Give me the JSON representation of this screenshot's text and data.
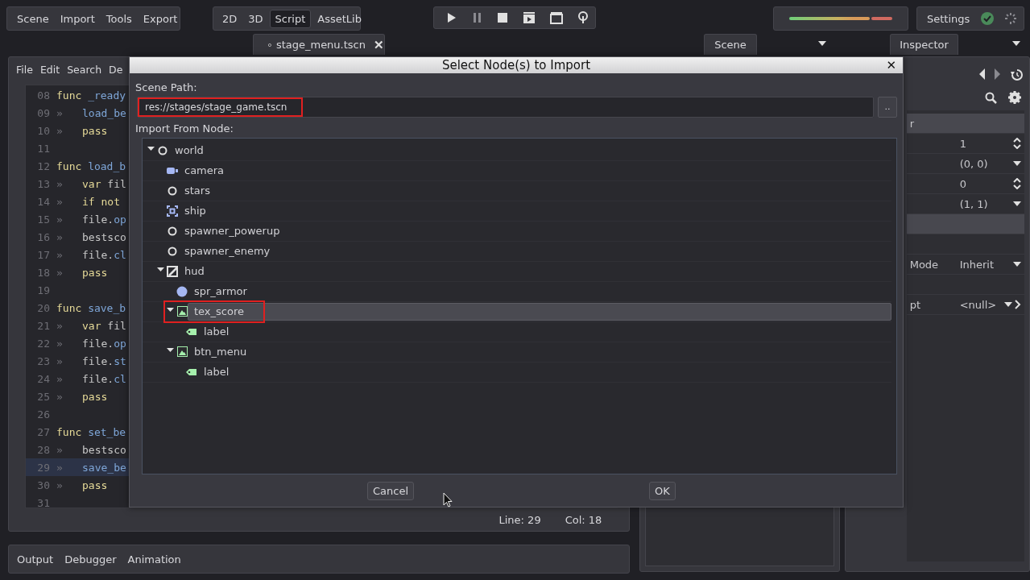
{
  "menu": [
    "Scene",
    "Import",
    "Tools",
    "Export"
  ],
  "main_tabs": [
    {
      "label": "2D",
      "selected": false
    },
    {
      "label": "3D",
      "selected": false
    },
    {
      "label": "Script",
      "selected": true
    },
    {
      "label": "AssetLib",
      "selected": false
    }
  ],
  "settings": {
    "label": "Settings"
  },
  "scene_tabs": [
    {
      "label": "stage_menu.tscn",
      "close": "✕"
    }
  ],
  "dock_tabs": {
    "scene": "Scene",
    "inspector": "Inspector"
  },
  "script_editor": {
    "menu": [
      "File",
      "Edit",
      "Search",
      "De"
    ],
    "lines": [
      {
        "number": "08",
        "tokens": [
          {
            "text": "func",
            "kind": "keyword"
          },
          {
            "text": " _ready",
            "kind": "name"
          }
        ],
        "current": false
      },
      {
        "number": "09",
        "indent": "»",
        "tokens": [
          {
            "text": "load_be",
            "kind": "name"
          }
        ],
        "current": false
      },
      {
        "number": "10",
        "indent": "»",
        "tokens": [
          {
            "text": "pass",
            "kind": "keyword"
          }
        ],
        "current": false
      },
      {
        "number": "11",
        "current": false
      },
      {
        "number": "12",
        "tokens": [
          {
            "text": "func",
            "kind": "keyword"
          },
          {
            "text": " load_b",
            "kind": "name"
          }
        ],
        "current": false
      },
      {
        "number": "13",
        "indent": "»",
        "tokens": [
          {
            "text": "var",
            "kind": "keyword"
          },
          {
            "text": " fil",
            "kind": "plain"
          }
        ],
        "current": false
      },
      {
        "number": "14",
        "indent": "»",
        "tokens": [
          {
            "text": "if not",
            "kind": "keyword"
          }
        ],
        "current": false
      },
      {
        "number": "15",
        "indent": "»",
        "tokens": [
          {
            "text": "file.",
            "kind": "plain"
          },
          {
            "text": "op",
            "kind": "name"
          }
        ],
        "current": false
      },
      {
        "number": "16",
        "indent": "»",
        "tokens": [
          {
            "text": "bestsco",
            "kind": "plain"
          }
        ],
        "current": false
      },
      {
        "number": "17",
        "indent": "»",
        "tokens": [
          {
            "text": "file.",
            "kind": "plain"
          },
          {
            "text": "cl",
            "kind": "name"
          }
        ],
        "current": false
      },
      {
        "number": "18",
        "indent": "»",
        "tokens": [
          {
            "text": "pass",
            "kind": "keyword"
          }
        ],
        "current": false
      },
      {
        "number": "19",
        "current": false
      },
      {
        "number": "20",
        "tokens": [
          {
            "text": "func",
            "kind": "keyword"
          },
          {
            "text": " save_b",
            "kind": "name"
          }
        ],
        "current": false
      },
      {
        "number": "21",
        "indent": "»",
        "tokens": [
          {
            "text": "var",
            "kind": "keyword"
          },
          {
            "text": " fil",
            "kind": "plain"
          }
        ],
        "current": false
      },
      {
        "number": "22",
        "indent": "»",
        "tokens": [
          {
            "text": "file.",
            "kind": "plain"
          },
          {
            "text": "op",
            "kind": "name"
          }
        ],
        "current": false
      },
      {
        "number": "23",
        "indent": "»",
        "tokens": [
          {
            "text": "file.",
            "kind": "plain"
          },
          {
            "text": "st",
            "kind": "name"
          }
        ],
        "current": false
      },
      {
        "number": "24",
        "indent": "»",
        "tokens": [
          {
            "text": "file.",
            "kind": "plain"
          },
          {
            "text": "cl",
            "kind": "name"
          }
        ],
        "current": false
      },
      {
        "number": "25",
        "indent": "»",
        "tokens": [
          {
            "text": "pass",
            "kind": "keyword"
          }
        ],
        "current": false
      },
      {
        "number": "26",
        "current": false
      },
      {
        "number": "27",
        "tokens": [
          {
            "text": "func",
            "kind": "keyword"
          },
          {
            "text": " set_be",
            "kind": "name"
          }
        ],
        "current": false
      },
      {
        "number": "28",
        "indent": "»",
        "tokens": [
          {
            "text": "bestsco",
            "kind": "plain"
          }
        ],
        "current": false
      },
      {
        "number": "29",
        "indent": "»",
        "tokens": [
          {
            "text": "save_be",
            "kind": "name"
          }
        ],
        "current": true
      },
      {
        "number": "30",
        "indent": "»",
        "tokens": [
          {
            "text": "pass",
            "kind": "keyword"
          }
        ],
        "current": false
      },
      {
        "number": "31",
        "current": false
      }
    ],
    "status": {
      "line": "Line: 29",
      "col": "Col: 18"
    }
  },
  "bottom_tabs": [
    "Output",
    "Debugger",
    "Animation"
  ],
  "inspector": {
    "rows": [
      {
        "kind": "header",
        "label": "r"
      },
      {
        "kind": "spin",
        "value": "1"
      },
      {
        "kind": "dropdown",
        "value": "(0, 0)"
      },
      {
        "kind": "spin",
        "value": "0"
      },
      {
        "kind": "dropdown",
        "value": "(1, 1)"
      },
      {
        "kind": "header"
      },
      {
        "kind": "blank"
      },
      {
        "kind": "dropdown",
        "label": "Mode",
        "value": "Inherit"
      },
      {
        "kind": "blank"
      },
      {
        "kind": "resource",
        "label": "pt",
        "value": "<null>"
      }
    ]
  },
  "dialog": {
    "title": "Select Node(s) to Import",
    "close": "✕",
    "path_label": "Scene Path:",
    "path": {
      "value": "res://stages/stage_game.tscn",
      "annotated": true
    },
    "browse": "..",
    "tree_label": "Import From Node:",
    "tree": [
      {
        "label": "world",
        "kind": "node",
        "expanded": true,
        "selected": false,
        "annotated": false,
        "children": [
          {
            "label": "camera",
            "kind": "camera",
            "selected": false,
            "annotated": false
          },
          {
            "label": "stars",
            "kind": "node",
            "selected": false,
            "annotated": false
          },
          {
            "label": "ship",
            "kind": "frame",
            "selected": false,
            "annotated": false
          },
          {
            "label": "spawner_powerup",
            "kind": "node",
            "selected": false,
            "annotated": false
          },
          {
            "label": "spawner_enemy",
            "kind": "node",
            "selected": false,
            "annotated": false
          },
          {
            "label": "hud",
            "kind": "control",
            "expanded": true,
            "selected": false,
            "annotated": false,
            "children": [
              {
                "label": "spr_armor",
                "kind": "sprite",
                "selected": false,
                "annotated": false
              },
              {
                "label": "tex_score",
                "kind": "texture",
                "expanded": true,
                "selected": true,
                "annotated": true,
                "children": [
                  {
                    "label": "label",
                    "kind": "label",
                    "selected": false,
                    "annotated": false
                  }
                ]
              },
              {
                "label": "btn_menu",
                "kind": "texture",
                "expanded": true,
                "selected": false,
                "annotated": false,
                "children": [
                  {
                    "label": "label",
                    "kind": "label",
                    "selected": false,
                    "annotated": false
                  }
                ]
              }
            ]
          }
        ]
      }
    ],
    "buttons": [
      "Cancel",
      "OK"
    ]
  }
}
